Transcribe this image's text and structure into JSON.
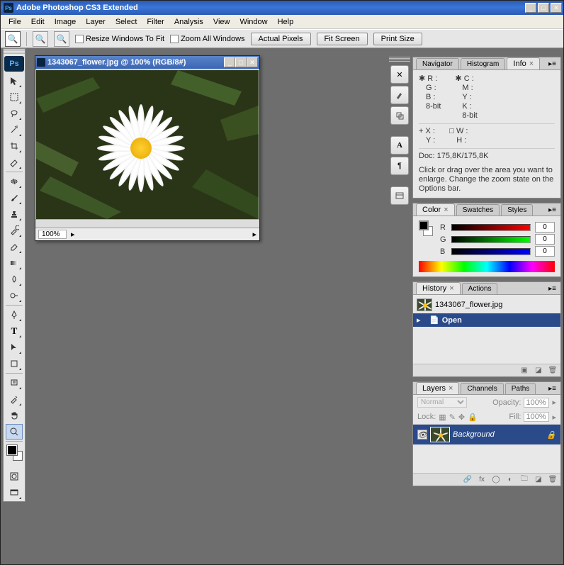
{
  "title": "Adobe Photoshop CS3 Extended",
  "menu": [
    "File",
    "Edit",
    "Image",
    "Layer",
    "Select",
    "Filter",
    "Analysis",
    "View",
    "Window",
    "Help"
  ],
  "options": {
    "resize_label": "Resize Windows To Fit",
    "zoom_all_label": "Zoom All Windows",
    "actual_pixels": "Actual Pixels",
    "fit_screen": "Fit Screen",
    "print_size": "Print Size"
  },
  "doc": {
    "title": "1343067_flower.jpg @ 100% (RGB/8#)",
    "zoom": "100%"
  },
  "info": {
    "tabs": [
      "Navigator",
      "Histogram",
      "Info"
    ],
    "r": "R :",
    "g": "G :",
    "b": "B :",
    "bit1": "8-bit",
    "c": "C :",
    "m": "M :",
    "y": "Y :",
    "k": "K :",
    "bit2": "8-bit",
    "x": "X :",
    "ycoord": "Y :",
    "w": "W :",
    "h": "H :",
    "docsize": "Doc: 175,8K/175,8K",
    "hint": "Click or drag over the area you want to enlarge. Change the zoom state on the Options bar."
  },
  "color": {
    "tabs": [
      "Color",
      "Swatches",
      "Styles"
    ],
    "r": "R",
    "g": "G",
    "b": "B",
    "rv": "0",
    "gv": "0",
    "bv": "0"
  },
  "history": {
    "tabs": [
      "History",
      "Actions"
    ],
    "file": "1343067_flower.jpg",
    "open": "Open"
  },
  "layers": {
    "tabs": [
      "Layers",
      "Channels",
      "Paths"
    ],
    "mode": "Normal",
    "opacity_l": "Opacity:",
    "opacity_v": "100%",
    "lock_l": "Lock:",
    "fill_l": "Fill:",
    "fill_v": "100%",
    "bg": "Background"
  }
}
